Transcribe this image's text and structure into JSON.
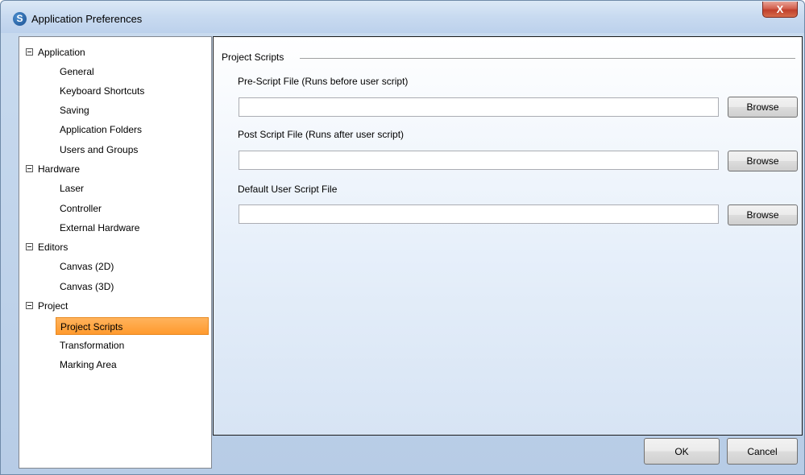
{
  "window": {
    "title": "Application Preferences",
    "logo_letter": "S",
    "close_glyph": "X",
    "icons": [
      "app-logo-icon",
      "close-icon"
    ]
  },
  "tree": {
    "nodes": [
      {
        "label": "Application",
        "type": "group"
      },
      {
        "label": "General",
        "type": "item"
      },
      {
        "label": "Keyboard Shortcuts",
        "type": "item"
      },
      {
        "label": "Saving",
        "type": "item"
      },
      {
        "label": "Application Folders",
        "type": "item"
      },
      {
        "label": "Users and Groups",
        "type": "item"
      },
      {
        "label": "Hardware",
        "type": "group"
      },
      {
        "label": "Laser",
        "type": "item"
      },
      {
        "label": "Controller",
        "type": "item"
      },
      {
        "label": "External Hardware",
        "type": "item"
      },
      {
        "label": "Editors",
        "type": "group"
      },
      {
        "label": "Canvas (2D)",
        "type": "item"
      },
      {
        "label": "Canvas (3D)",
        "type": "item"
      },
      {
        "label": "Project",
        "type": "group"
      },
      {
        "label": "Project Scripts",
        "type": "item",
        "selected": true
      },
      {
        "label": "Transformation",
        "type": "item"
      },
      {
        "label": "Marking Area",
        "type": "item"
      }
    ]
  },
  "main": {
    "group_title": "Project Scripts",
    "fields": [
      {
        "label": "Pre-Script File (Runs before user script)",
        "value": "",
        "button": "Browse"
      },
      {
        "label": "Post Script File (Runs after user script)",
        "value": "",
        "button": "Browse"
      },
      {
        "label": "Default User Script File",
        "value": "",
        "button": "Browse"
      }
    ]
  },
  "footer": {
    "ok_label": "OK",
    "cancel_label": "Cancel"
  },
  "colors": {
    "selected_bg": "#ff9a2e",
    "panel_border": "#1a1a1a",
    "close_button": "#c0402c"
  }
}
